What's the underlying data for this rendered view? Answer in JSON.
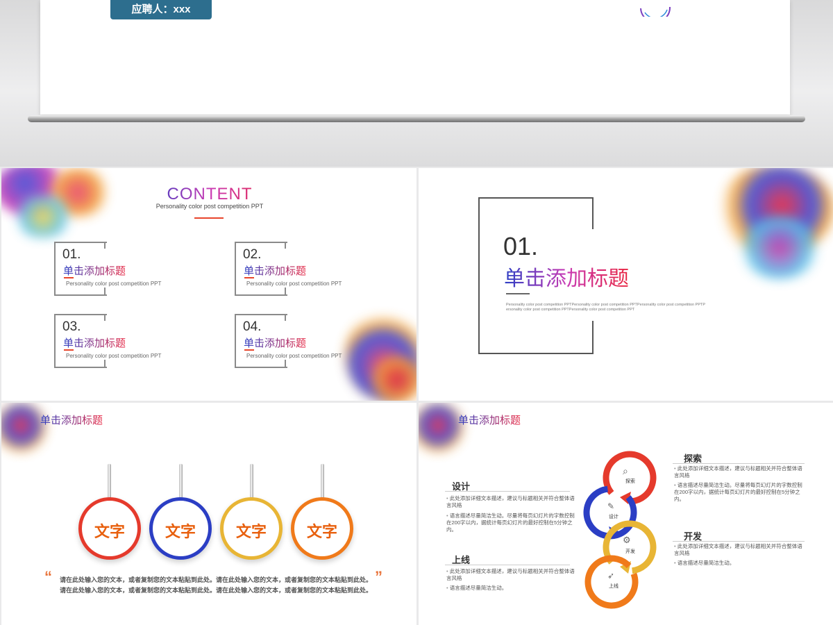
{
  "top": {
    "applicant": "应聘人：xxx"
  },
  "content_slide": {
    "title": "CONTENT",
    "subtitle": "Personality color post competition PPT",
    "items": [
      {
        "num": "01.",
        "title": "单击添加标题",
        "desc": "Personality color post competition PPT"
      },
      {
        "num": "02.",
        "title": "单击添加标题",
        "desc": "Personality color post competition PPT"
      },
      {
        "num": "03.",
        "title": "单击添加标题",
        "desc": "Personality color post competition PPT"
      },
      {
        "num": "04.",
        "title": "单击添加标题",
        "desc": "Personality color post competition PPT"
      }
    ]
  },
  "section_slide": {
    "num": "01.",
    "title": "单击添加标题",
    "desc": "Personality color post competition PPTPersonality color post competition PPTPersonality color post competition PPTPersonality color post competition PPTPersonality color post competition PPT"
  },
  "circles_slide": {
    "header": "单击添加标题",
    "circles": [
      {
        "label": "文字",
        "color": "#e53a2c"
      },
      {
        "label": "文字",
        "color": "#2b3ec4"
      },
      {
        "label": "文字",
        "color": "#e8b535"
      },
      {
        "label": "文字",
        "color": "#f07a1a"
      }
    ],
    "quote_line1": "请在此处输入您的文本，或者复制您的文本粘贴到此处。请在此处输入您的文本，或者复制您的文本粘贴到此处。",
    "quote_line2": "请在此处输入您的文本，或者复制您的文本粘贴到此处。请在此处输入您的文本，或者复制您的文本粘贴到此处。"
  },
  "process_slide": {
    "header": "单击添加标题",
    "sections": {
      "design": {
        "title": "设计",
        "b1": "此处添加详细文本描述，建议与标题相关并符合整体语言风格",
        "b2": "语言描述尽量简洁生动。尽量将每页幻灯片的字数控制在200字以内，据统计每页幻灯片的最好控制在5分钟之内。"
      },
      "launch": {
        "title": "上线",
        "b1": "此处添加详细文本描述，建议与标题相关并符合整体语言风格",
        "b2": "语言描述尽量简洁生动。"
      },
      "explore": {
        "title": "探索",
        "b1": "此处添加详细文本描述，建议与标题相关并符合整体语言风格",
        "b2": "语言描述尽量简洁生动。尽量将每页幻灯片的字数控制在200字以内，据统计每页幻灯片的最好控制在5分钟之内。"
      },
      "develop": {
        "title": "开发",
        "b1": "此处添加详细文本描述，建议与标题相关并符合整体语言风格",
        "b2": "语言描述尽量简洁生动。"
      }
    },
    "steps": [
      {
        "label": "探索",
        "icon": "search-icon",
        "color": "#e53a2c"
      },
      {
        "label": "设计",
        "icon": "pencil-icon",
        "color": "#2b3ec4"
      },
      {
        "label": "开发",
        "icon": "gear-icon",
        "color": "#e8b535"
      },
      {
        "label": "上线",
        "icon": "rocket-icon",
        "color": "#f07a1a"
      }
    ]
  }
}
